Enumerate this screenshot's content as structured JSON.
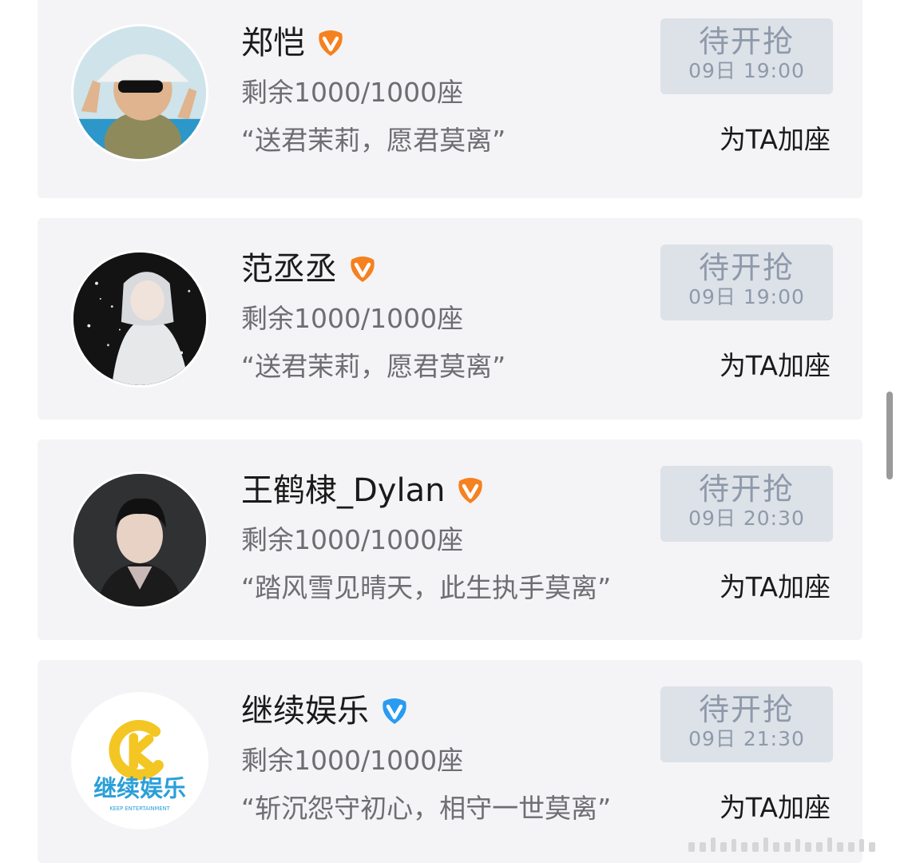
{
  "colors": {
    "card_bg": "#f4f4f6",
    "button_bg": "#dde1e8",
    "button_text": "#8e9aaa",
    "secondary_text": "#6d6d72",
    "primary_text": "#1a1a1a",
    "verified_orange": "#f5811f",
    "verified_blue": "#2a9bf0"
  },
  "cards": [
    {
      "name": "郑恺",
      "verified_icon": "orange-verified-v-icon",
      "seats": "剩余1000/1000座",
      "slogan": "“送君茉莉，愿君莫离”",
      "status_label": "待开抢",
      "status_time": "09日 19:00",
      "add_seat_label": "为TA加座"
    },
    {
      "name": "范丞丞",
      "verified_icon": "orange-verified-v-icon",
      "seats": "剩余1000/1000座",
      "slogan": "“送君茉莉，愿君莫离”",
      "status_label": "待开抢",
      "status_time": "09日 19:00",
      "add_seat_label": "为TA加座"
    },
    {
      "name": "王鹤棣_Dylan",
      "verified_icon": "orange-verified-v-icon",
      "seats": "剩余1000/1000座",
      "slogan": "“踏风雪见晴天，此生执手莫离”",
      "status_label": "待开抢",
      "status_time": "09日 20:30",
      "add_seat_label": "为TA加座"
    },
    {
      "name": "继续娱乐",
      "verified_icon": "blue-verified-v-icon",
      "seats": "剩余1000/1000座",
      "slogan": "“斩沉怨守初心，相守一世莫离”",
      "status_label": "待开抢",
      "status_time": "09日 21:30",
      "add_seat_label": "为TA加座",
      "logo_text": "继续娱乐",
      "logo_subtext": "KEEP ENTERTAINMENT"
    }
  ]
}
